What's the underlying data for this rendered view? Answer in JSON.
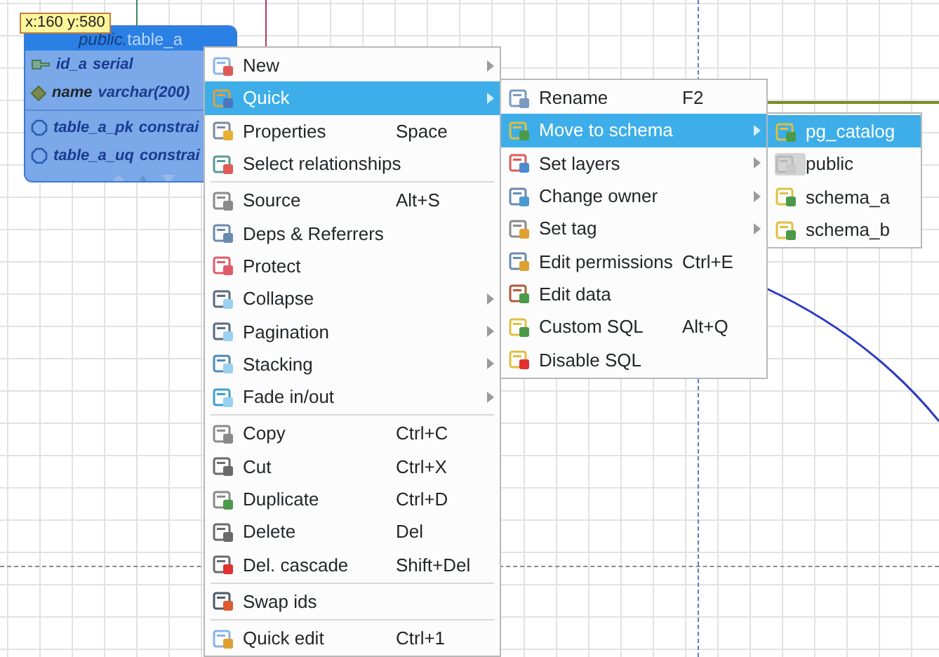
{
  "diagram": {
    "tooltip": "x:160 y:580",
    "table": {
      "schema": "public.",
      "name": "table_a",
      "columns": [
        {
          "kind": "key",
          "name": "id_a",
          "type": "serial"
        },
        {
          "kind": "plain",
          "name": "name",
          "type": "varchar(200)"
        }
      ],
      "constraints": [
        {
          "name": "table_a_pk",
          "type": "constrai"
        },
        {
          "name": "table_a_uq",
          "type": "constrai"
        }
      ]
    }
  },
  "context_menu": {
    "items": [
      {
        "kind": "item",
        "label": "New",
        "submenu": true,
        "selected": false
      },
      {
        "kind": "item",
        "label": "Quick",
        "submenu": true,
        "selected": true
      },
      {
        "kind": "item",
        "label": "Properties",
        "shortcut": "Space",
        "submenu": false,
        "selected": false
      },
      {
        "kind": "item",
        "label": "Select relationships",
        "submenu": false,
        "selected": false
      },
      {
        "kind": "separator"
      },
      {
        "kind": "item",
        "label": "Source",
        "shortcut": "Alt+S",
        "submenu": false,
        "selected": false
      },
      {
        "kind": "item",
        "label": "Deps & Referrers",
        "submenu": false,
        "selected": false
      },
      {
        "kind": "item",
        "label": "Protect",
        "submenu": false,
        "selected": false
      },
      {
        "kind": "item",
        "label": "Collapse",
        "submenu": true,
        "selected": false
      },
      {
        "kind": "item",
        "label": "Pagination",
        "submenu": true,
        "selected": false
      },
      {
        "kind": "item",
        "label": "Stacking",
        "submenu": true,
        "selected": false
      },
      {
        "kind": "item",
        "label": "Fade in/out",
        "submenu": true,
        "selected": false
      },
      {
        "kind": "separator"
      },
      {
        "kind": "item",
        "label": "Copy",
        "shortcut": "Ctrl+C",
        "submenu": false,
        "selected": false
      },
      {
        "kind": "item",
        "label": "Cut",
        "shortcut": "Ctrl+X",
        "submenu": false,
        "selected": false
      },
      {
        "kind": "item",
        "label": "Duplicate",
        "shortcut": "Ctrl+D",
        "submenu": false,
        "selected": false
      },
      {
        "kind": "item",
        "label": "Delete",
        "shortcut": "Del",
        "submenu": false,
        "selected": false
      },
      {
        "kind": "item",
        "label": "Del. cascade",
        "shortcut": "Shift+Del",
        "submenu": false,
        "selected": false
      },
      {
        "kind": "separator"
      },
      {
        "kind": "item",
        "label": "Swap ids",
        "submenu": false,
        "selected": false
      },
      {
        "kind": "separator"
      },
      {
        "kind": "item",
        "label": "Quick edit",
        "shortcut": "Ctrl+1",
        "submenu": false,
        "selected": false
      }
    ]
  },
  "quick_menu": {
    "items": [
      {
        "kind": "item",
        "label": "Rename",
        "shortcut": "F2",
        "submenu": false,
        "selected": false
      },
      {
        "kind": "item",
        "label": "Move to schema",
        "submenu": true,
        "selected": true
      },
      {
        "kind": "item",
        "label": "Set layers",
        "submenu": true,
        "selected": false
      },
      {
        "kind": "item",
        "label": "Change owner",
        "submenu": true,
        "selected": false
      },
      {
        "kind": "item",
        "label": "Set tag",
        "submenu": true,
        "selected": false
      },
      {
        "kind": "item",
        "label": "Edit permissions",
        "shortcut": "Ctrl+E",
        "submenu": false,
        "selected": false
      },
      {
        "kind": "item",
        "label": "Edit data",
        "submenu": false,
        "selected": false
      },
      {
        "kind": "item",
        "label": "Custom SQL",
        "shortcut": "Alt+Q",
        "submenu": false,
        "selected": false
      },
      {
        "kind": "item",
        "label": "Disable SQL",
        "submenu": false,
        "selected": false
      }
    ]
  },
  "schema_menu": {
    "items": [
      {
        "label": "pg_catalog",
        "current": false,
        "selected": true
      },
      {
        "label": "public",
        "current": true,
        "selected": false
      },
      {
        "label": "schema_a",
        "current": false,
        "selected": false
      },
      {
        "label": "schema_b",
        "current": false,
        "selected": false
      }
    ]
  }
}
